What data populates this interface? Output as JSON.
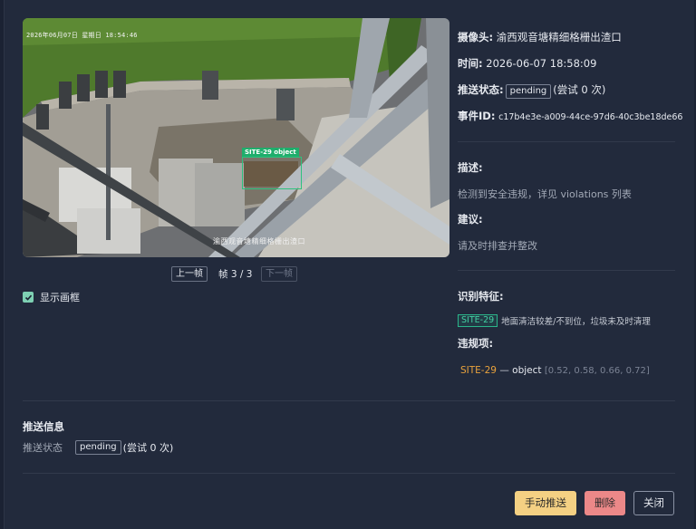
{
  "camera_feed": {
    "timestamp": "2026年06月07日  星期日  18:54:46",
    "watermark": "渝西观音塘精细格栅出渣口",
    "detection_label": "SITE-29 object"
  },
  "pager": {
    "prev_label": "上一帧",
    "frame_info": "帧 3 / 3",
    "next_label": "下一帧"
  },
  "show_boxes": {
    "label": "显示画框",
    "checked": true
  },
  "details": {
    "camera_label": "摄像头:",
    "camera_value": "渝西观音塘精细格栅出渣口",
    "time_label": "时间:",
    "time_value": "2026-06-07 18:58:09",
    "push_status_label": "推送状态:",
    "push_status_value": "pending",
    "push_attempts": "(尝试 0 次)",
    "event_id_label": "事件ID:",
    "event_id_value": "c17b4e3e-a009-44ce-97d6-40c3be18de66"
  },
  "description": {
    "title": "描述:",
    "text": "检测到安全违规，详见 violations 列表"
  },
  "suggestion": {
    "title": "建议:",
    "text": "请及时排查并整改"
  },
  "features": {
    "title": "识别特征:",
    "tag": "SITE-29",
    "text": "地面清洁较差/不到位，垃圾未及时清理"
  },
  "violations": {
    "title": "违规项:",
    "items": [
      {
        "code": "SITE-29",
        "separator": "—",
        "name": "object",
        "bbox_text": "[0.52, 0.58, 0.66, 0.72]"
      }
    ]
  },
  "push_info": {
    "title": "推送信息",
    "status_label": "推送状态",
    "status_value": "pending",
    "attempts": "(尝试 0 次)"
  },
  "footer": {
    "manual_push_label": "手动推送",
    "delete_label": "删除",
    "close_label": "关闭"
  },
  "colors": {
    "background": "#222a3c",
    "accent_teal": "#2bb58a",
    "violation_code": "#e8a23c",
    "push_button": "#f4d083",
    "delete_button": "#ec8888"
  }
}
